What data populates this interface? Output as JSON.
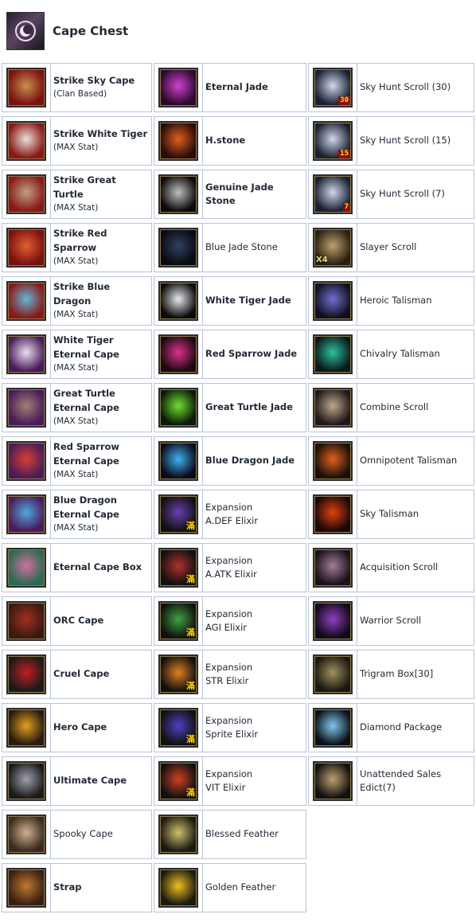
{
  "header": {
    "title": "Cape Chest",
    "icon": "moon-emblem-icon"
  },
  "columns": [
    [
      {
        "lines": [
          "Strike Sky Cape"
        ],
        "sub": "(Clan Based)",
        "bold": true,
        "icon": "strike-sky-cape-icon",
        "c1": "#7a1010",
        "c2": "#c89050"
      },
      {
        "lines": [
          "Strike White Tiger"
        ],
        "sub": "(MAX Stat)",
        "bold": true,
        "icon": "strike-white-tiger-icon",
        "c1": "#8a1818",
        "c2": "#e8e0d8"
      },
      {
        "lines": [
          "Strike Great Turtle"
        ],
        "sub": "(MAX Stat)",
        "bold": true,
        "icon": "strike-great-turtle-icon",
        "c1": "#8a1818",
        "c2": "#c0a080"
      },
      {
        "lines": [
          "Strike Red Sparrow"
        ],
        "sub": "(MAX Stat)",
        "bold": true,
        "icon": "strike-red-sparrow-icon",
        "c1": "#7a1010",
        "c2": "#e06030"
      },
      {
        "lines": [
          "Strike Blue Dragon"
        ],
        "sub": "(MAX Stat)",
        "bold": true,
        "icon": "strike-blue-dragon-icon",
        "c1": "#8a1818",
        "c2": "#60b8d8"
      },
      {
        "lines": [
          "White Tiger",
          "Eternal Cape"
        ],
        "sub": "(MAX Stat)",
        "bold": true,
        "icon": "white-tiger-eternal-cape-icon",
        "c1": "#4a1a5a",
        "c2": "#e8e0f0"
      },
      {
        "lines": [
          "Great Turtle",
          "Eternal Cape"
        ],
        "sub": "(MAX Stat)",
        "bold": true,
        "icon": "great-turtle-eternal-cape-icon",
        "c1": "#4a1a5a",
        "c2": "#a08070"
      },
      {
        "lines": [
          "Red Sparrow",
          "Eternal Cape"
        ],
        "sub": "(MAX Stat)",
        "bold": true,
        "icon": "red-sparrow-eternal-cape-icon",
        "c1": "#4a1a5a",
        "c2": "#d84030"
      },
      {
        "lines": [
          "Blue Dragon",
          "Eternal Cape"
        ],
        "sub": "(MAX Stat)",
        "bold": true,
        "icon": "blue-dragon-eternal-cape-icon",
        "c1": "#4a1a5a",
        "c2": "#50a8e0"
      },
      {
        "lines": [
          "Eternal Cape Box"
        ],
        "sub": "",
        "bold": true,
        "icon": "eternal-cape-box-icon",
        "c1": "#2a6a50",
        "c2": "#d070a0"
      },
      {
        "lines": [
          "ORC Cape"
        ],
        "sub": "",
        "bold": true,
        "icon": "orc-cape-icon",
        "c1": "#3a1a10",
        "c2": "#a03020"
      },
      {
        "lines": [
          "Cruel Cape"
        ],
        "sub": "",
        "bold": true,
        "icon": "cruel-cape-icon",
        "c1": "#1a1a1a",
        "c2": "#c02020"
      },
      {
        "lines": [
          "Hero Cape"
        ],
        "sub": "",
        "bold": true,
        "icon": "hero-cape-icon",
        "c1": "#2a1a10",
        "c2": "#e0a020"
      },
      {
        "lines": [
          "Ultimate Cape"
        ],
        "sub": "",
        "bold": true,
        "icon": "ultimate-cape-icon",
        "c1": "#1a1a1a",
        "c2": "#a0a0b0"
      },
      {
        "lines": [
          "Spooky Cape"
        ],
        "sub": "",
        "bold": false,
        "icon": "spooky-cape-icon",
        "c1": "#3a2a20",
        "c2": "#d0b090"
      },
      {
        "lines": [
          "Strap"
        ],
        "sub": "",
        "bold": true,
        "icon": "strap-icon",
        "c1": "#3a2010",
        "c2": "#c07830"
      }
    ],
    [
      {
        "lines": [
          "Eternal Jade"
        ],
        "sub": "",
        "bold": true,
        "icon": "eternal-jade-icon",
        "c1": "#2a0a2a",
        "c2": "#d040d0"
      },
      {
        "lines": [
          "H.stone"
        ],
        "sub": "",
        "bold": true,
        "icon": "h-stone-icon",
        "c1": "#2a0a0a",
        "c2": "#e06020"
      },
      {
        "lines": [
          "Genuine Jade Stone"
        ],
        "sub": "",
        "bold": true,
        "icon": "genuine-jade-stone-icon",
        "c1": "#0a0a0a",
        "c2": "#c0c0c0"
      },
      {
        "lines": [
          "Blue Jade Stone"
        ],
        "sub": "",
        "bold": false,
        "icon": "blue-jade-stone-icon",
        "c1": "#0a0a10",
        "c2": "#304060"
      },
      {
        "lines": [
          "White Tiger Jade"
        ],
        "sub": "",
        "bold": true,
        "icon": "white-tiger-jade-icon",
        "c1": "#0a0a0a",
        "c2": "#e8e8f0"
      },
      {
        "lines": [
          "Red Sparrow Jade"
        ],
        "sub": "",
        "bold": true,
        "icon": "red-sparrow-jade-icon",
        "c1": "#1a0a10",
        "c2": "#e03090"
      },
      {
        "lines": [
          "Great Turtle Jade"
        ],
        "sub": "",
        "bold": true,
        "icon": "great-turtle-jade-icon",
        "c1": "#0a1a0a",
        "c2": "#70e030"
      },
      {
        "lines": [
          "Blue Dragon Jade"
        ],
        "sub": "",
        "bold": true,
        "icon": "blue-dragon-jade-icon",
        "c1": "#0a0a1a",
        "c2": "#40b0f0"
      },
      {
        "lines": [
          "Expansion",
          "A.DEF Elixir"
        ],
        "sub": "",
        "bold": false,
        "icon": "a-def-elixir-icon",
        "c1": "#101010",
        "c2": "#6a40b0",
        "corner": "滿"
      },
      {
        "lines": [
          "Expansion",
          "A.ATK Elixir"
        ],
        "sub": "",
        "bold": false,
        "icon": "a-atk-elixir-icon",
        "c1": "#101010",
        "c2": "#b03030",
        "corner": "滿"
      },
      {
        "lines": [
          "Expansion",
          "AGI Elixir"
        ],
        "sub": "",
        "bold": false,
        "icon": "agi-elixir-icon",
        "c1": "#101010",
        "c2": "#40a040",
        "corner": "滿"
      },
      {
        "lines": [
          "Expansion",
          "STR Elixir"
        ],
        "sub": "",
        "bold": false,
        "icon": "str-elixir-icon",
        "c1": "#101010",
        "c2": "#e08020",
        "corner": "滿"
      },
      {
        "lines": [
          "Expansion",
          "Sprite Elixir"
        ],
        "sub": "",
        "bold": false,
        "icon": "sprite-elixir-icon",
        "c1": "#101010",
        "c2": "#5040c0",
        "corner": "滿"
      },
      {
        "lines": [
          "Expansion",
          "VIT Elixir"
        ],
        "sub": "",
        "bold": false,
        "icon": "vit-elixir-icon",
        "c1": "#101010",
        "c2": "#d04020",
        "corner": "滿"
      },
      {
        "lines": [
          "Blessed Feather"
        ],
        "sub": "",
        "bold": false,
        "icon": "blessed-feather-icon",
        "c1": "#1a1a10",
        "c2": "#d0c070"
      },
      {
        "lines": [
          "Golden Feather"
        ],
        "sub": "",
        "bold": false,
        "icon": "golden-feather-icon",
        "c1": "#1a1a10",
        "c2": "#f0c020"
      }
    ],
    [
      {
        "lines": [
          "Sky Hunt Scroll (30)"
        ],
        "sub": "",
        "bold": false,
        "icon": "sky-hunt-scroll-30-icon",
        "c1": "#1a2030",
        "c2": "#d0d8f0",
        "badge": "30"
      },
      {
        "lines": [
          "Sky Hunt Scroll (15)"
        ],
        "sub": "",
        "bold": false,
        "icon": "sky-hunt-scroll-15-icon",
        "c1": "#1a2030",
        "c2": "#d0d8f0",
        "badge": "15"
      },
      {
        "lines": [
          "Sky Hunt Scroll (7)"
        ],
        "sub": "",
        "bold": false,
        "icon": "sky-hunt-scroll-7-icon",
        "c1": "#1a2030",
        "c2": "#d0d8f0",
        "badge": "7"
      },
      {
        "lines": [
          "Slayer Scroll"
        ],
        "sub": "",
        "bold": false,
        "icon": "slayer-scroll-icon",
        "c1": "#2a2010",
        "c2": "#c0a070",
        "badgeLeft": "X4"
      },
      {
        "lines": [
          "Heroic Talisman"
        ],
        "sub": "",
        "bold": false,
        "icon": "heroic-talisman-icon",
        "c1": "#101020",
        "c2": "#7070d0"
      },
      {
        "lines": [
          "Chivalry Talisman"
        ],
        "sub": "",
        "bold": false,
        "icon": "chivalry-talisman-icon",
        "c1": "#0a1a1a",
        "c2": "#30c0a0"
      },
      {
        "lines": [
          "Combine Scroll"
        ],
        "sub": "",
        "bold": false,
        "icon": "combine-scroll-icon",
        "c1": "#201818",
        "c2": "#c0a890"
      },
      {
        "lines": [
          "Omnipotent Talisman"
        ],
        "sub": "",
        "bold": false,
        "icon": "omnipotent-talisman-icon",
        "c1": "#1a1008",
        "c2": "#e06020"
      },
      {
        "lines": [
          "Sky Talisman"
        ],
        "sub": "",
        "bold": false,
        "icon": "sky-talisman-icon",
        "c1": "#1a0808",
        "c2": "#e04010"
      },
      {
        "lines": [
          "Acquisition Scroll"
        ],
        "sub": "",
        "bold": false,
        "icon": "acquisition-scroll-icon",
        "c1": "#1a1018",
        "c2": "#a08098"
      },
      {
        "lines": [
          "Warrior Scroll"
        ],
        "sub": "",
        "bold": false,
        "icon": "warrior-scroll-icon",
        "c1": "#100a18",
        "c2": "#9040c0"
      },
      {
        "lines": [
          "Trigram Box[30]"
        ],
        "sub": "",
        "bold": false,
        "icon": "trigram-box-icon",
        "c1": "#1a1810",
        "c2": "#a09060"
      },
      {
        "lines": [
          "Diamond Package"
        ],
        "sub": "",
        "bold": false,
        "icon": "diamond-package-icon",
        "c1": "#0a1018",
        "c2": "#80c8f0"
      },
      {
        "lines": [
          "Unattended Sales Edict(7)"
        ],
        "sub": "",
        "bold": false,
        "icon": "sales-edict-icon",
        "c1": "#101010",
        "c2": "#c0a070"
      }
    ]
  ]
}
